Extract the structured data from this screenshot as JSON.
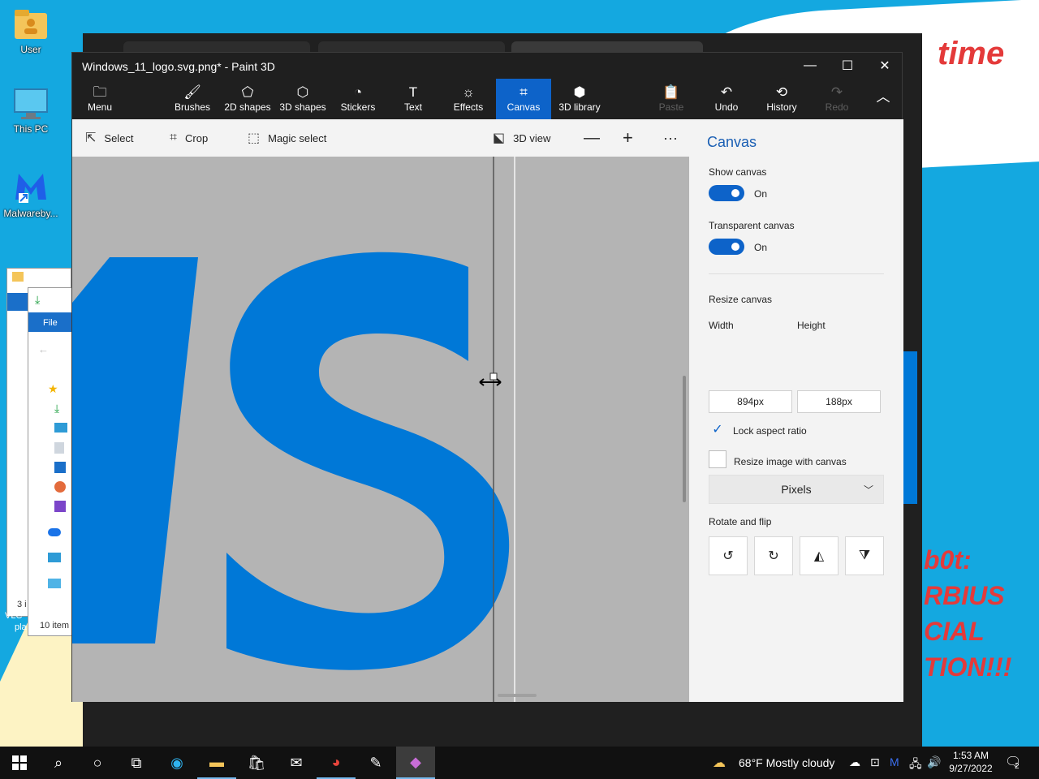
{
  "desktop": {
    "icons": [
      {
        "label": "User",
        "icon": "folder-user-icon"
      },
      {
        "label": "This PC",
        "icon": "monitor-icon"
      },
      {
        "label": "Malwareby...",
        "icon": "malwarebytes-icon"
      }
    ],
    "cloud_text": "time",
    "red_lines": [
      "b0t:",
      "RBIUS",
      "CIAL",
      "TION!!!"
    ]
  },
  "explorer": {
    "file_tab": "File",
    "item_count": "10 item",
    "left_label": "3 i",
    "left_label2": "VLC",
    "left_label3": "pla"
  },
  "paint": {
    "title": "Windows_11_logo.svg.png* - Paint 3D",
    "ribbon": [
      {
        "label": "Menu",
        "icon": "menu-folder-icon"
      },
      {
        "label": "Brushes",
        "icon": "brush-icon"
      },
      {
        "label": "2D shapes",
        "icon": "2d-shapes-icon"
      },
      {
        "label": "3D shapes",
        "icon": "3d-shapes-icon"
      },
      {
        "label": "Stickers",
        "icon": "stickers-icon"
      },
      {
        "label": "Text",
        "icon": "text-icon"
      },
      {
        "label": "Effects",
        "icon": "effects-icon"
      },
      {
        "label": "Canvas",
        "icon": "canvas-icon"
      },
      {
        "label": "3D library",
        "icon": "3d-library-icon"
      }
    ],
    "ribbon_right": [
      {
        "label": "Paste",
        "icon": "paste-icon"
      },
      {
        "label": "Undo",
        "icon": "undo-icon"
      },
      {
        "label": "History",
        "icon": "history-icon"
      },
      {
        "label": "Redo",
        "icon": "redo-icon"
      }
    ],
    "toolbar": {
      "select": "Select",
      "crop": "Crop",
      "magic_select": "Magic select",
      "view_3d": "3D view"
    },
    "panel": {
      "heading": "Canvas",
      "show_canvas": "Show canvas",
      "show_canvas_state": "On",
      "transparent_canvas": "Transparent canvas",
      "transparent_canvas_state": "On",
      "resize_canvas": "Resize canvas",
      "width_label": "Width",
      "height_label": "Height",
      "width_value": "894px",
      "height_value": "188px",
      "lock_aspect": "Lock aspect ratio",
      "resize_image": "Resize image with canvas",
      "units": "Pixels",
      "rotate_flip": "Rotate and flip"
    }
  },
  "taskbar": {
    "weather": "68°F  Mostly cloudy",
    "time": "1:53 AM",
    "date": "9/27/2022",
    "notifications": "2"
  },
  "colors": {
    "accent": "#0d63c9",
    "logo_blue": "#0078d7",
    "canvas_gray": "#b4b4b4"
  }
}
